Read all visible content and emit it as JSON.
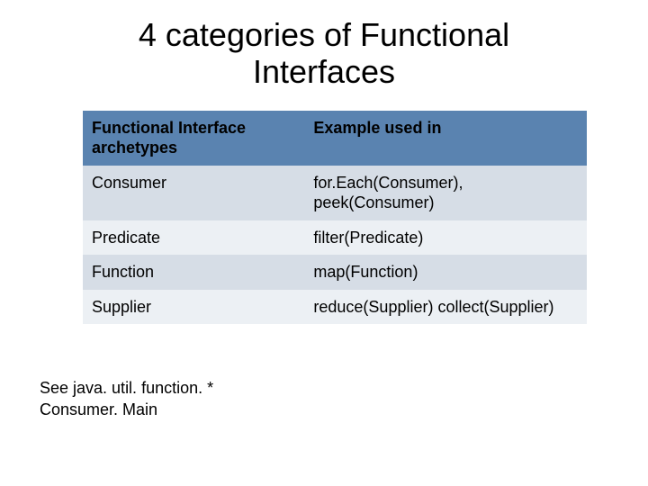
{
  "title": "4 categories of Functional Interfaces",
  "table": {
    "headers": {
      "col1": "Functional Interface archetypes",
      "col2": "Example used in"
    },
    "rows": [
      {
        "archetype": "Consumer",
        "example": "for.Each(Consumer), peek(Consumer)"
      },
      {
        "archetype": "Predicate",
        "example": "filter(Predicate)"
      },
      {
        "archetype": "Function",
        "example": "map(Function)"
      },
      {
        "archetype": "Supplier",
        "example": "reduce(Supplier) collect(Supplier)"
      }
    ]
  },
  "footnote": {
    "line1": "See java. util. function. *",
    "line2": "Consumer. Main"
  }
}
